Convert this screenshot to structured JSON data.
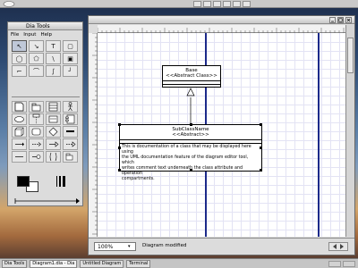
{
  "colors": {
    "page_break": "#1c2a8a",
    "grid": "#e3e3f4",
    "foreground": "#000000",
    "background": "#ffffff"
  },
  "toolbox": {
    "title": "Dia Tools",
    "menus": [
      "File",
      "Input",
      "Help"
    ],
    "tools": [
      {
        "name": "modify-tool",
        "glyph": "↖",
        "active": true
      },
      {
        "name": "magnify-tool",
        "glyph": "↘",
        "active": false
      },
      {
        "name": "text-tool",
        "glyph": "T",
        "active": false
      },
      {
        "name": "box-tool",
        "glyph": "▢",
        "active": false
      },
      {
        "name": "ellipse-tool",
        "glyph": "◯",
        "active": false
      },
      {
        "name": "polygon-tool",
        "glyph": "⬠",
        "active": false
      },
      {
        "name": "line-tool",
        "glyph": "\\",
        "active": false
      },
      {
        "name": "image-tool",
        "glyph": "▣",
        "active": false
      },
      {
        "name": "zigzag-tool",
        "glyph": "⌐",
        "active": false
      },
      {
        "name": "arc-tool",
        "glyph": "⌒",
        "active": false
      },
      {
        "name": "bezier-tool",
        "glyph": "∫",
        "active": false
      },
      {
        "name": "polyline-tool",
        "glyph": "╯",
        "active": false
      }
    ],
    "shapes": [
      "uml-note",
      "uml-package",
      "uml-class",
      "uml-actor",
      "uml-usecase",
      "uml-lifeline",
      "uml-object",
      "uml-component",
      "uml-node",
      "uml-state",
      "uml-branch",
      "uml-fork",
      "uml-message",
      "uml-dependency",
      "uml-generalization",
      "uml-realizes",
      "uml-association",
      "uml-implements",
      "uml-constraint",
      "uml-smallpackage"
    ]
  },
  "diagram": {
    "zoom_value": "100%",
    "status": "Diagram modified",
    "class_top": {
      "name": "Base",
      "stereotype": "<<Abstract Class>>"
    },
    "class_main": {
      "name": "SubClassName",
      "stereotype": "<<Abstract>>",
      "doc_lines": [
        "This is documentation of a class that may be displayed here using",
        "the UML documentation feature of the diagram editor tool, which",
        "writes comment text underneath the class attribute and operation",
        "compartments."
      ]
    }
  },
  "taskbar": {
    "items": [
      {
        "label": "Dia Tools",
        "active": false
      },
      {
        "label": "Diagram1.dia - Dia",
        "active": true
      },
      {
        "label": "Untitled Diagram",
        "active": false
      },
      {
        "label": "Terminal",
        "active": false
      }
    ]
  }
}
